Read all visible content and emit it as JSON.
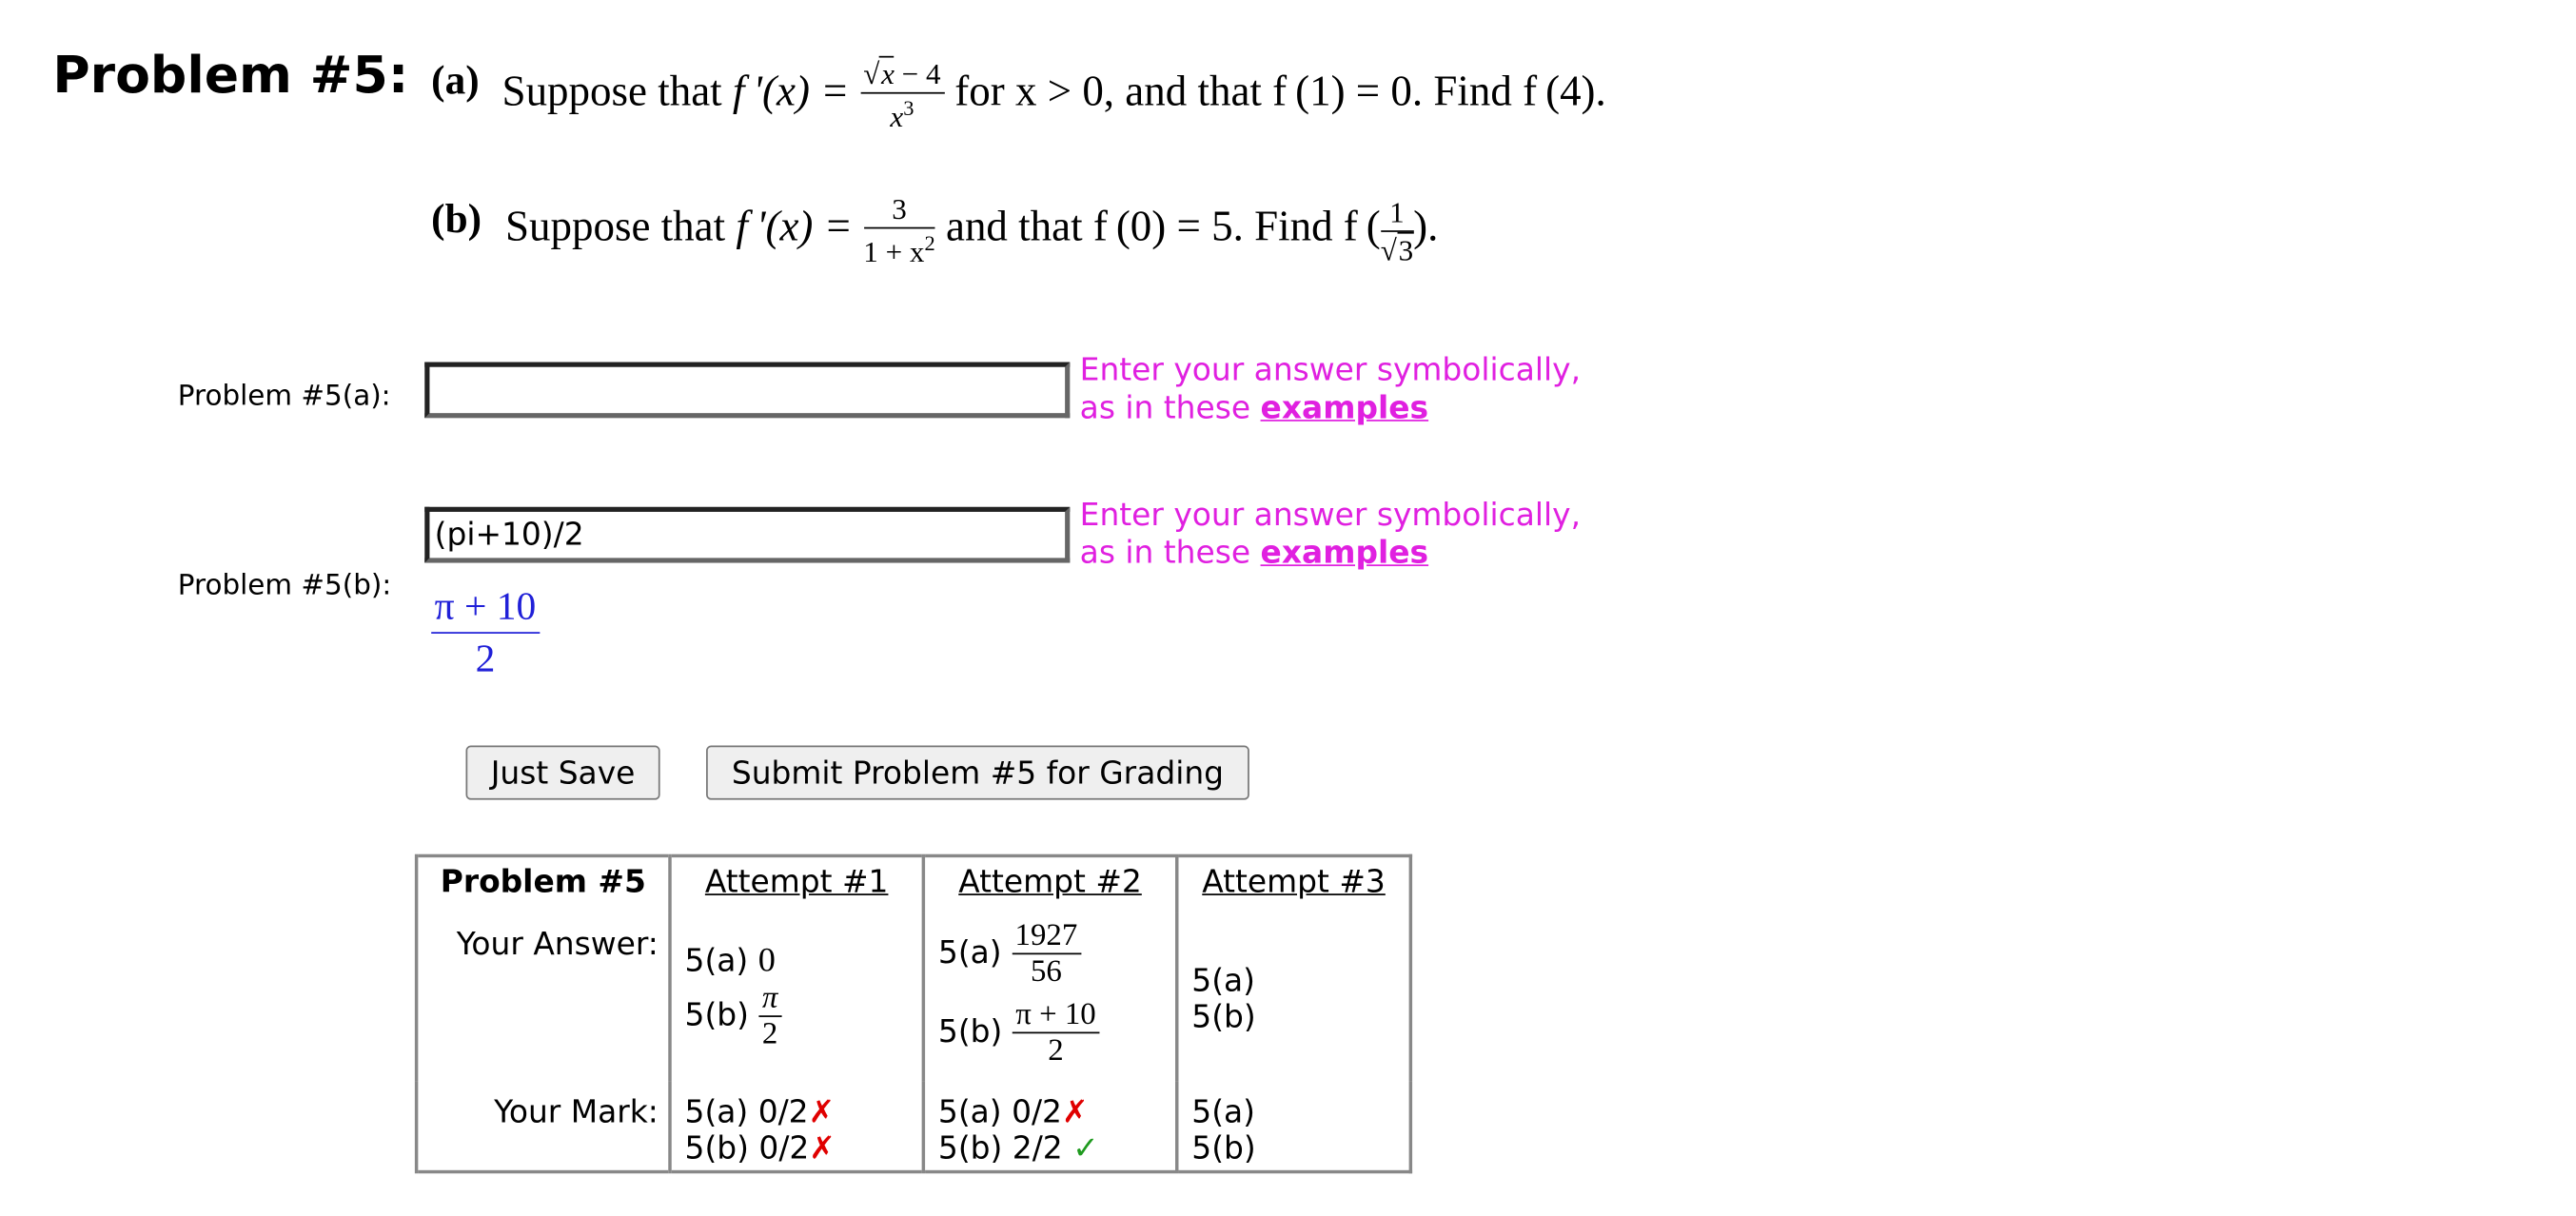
{
  "problem": {
    "title": "Problem #5:",
    "part_a_label": "(a)",
    "part_b_label": "(b)",
    "a_text_1": "Suppose that ",
    "a_fp": "f '(x) = ",
    "a_num": "x",
    "a_num_rest": " − 4",
    "a_den": "x",
    "a_den_exp": "3",
    "a_text_2": " for x > 0, and that f (1) = 0. Find  f (4).",
    "b_text_1": "Suppose that ",
    "b_fp": "f '(x) = ",
    "b_num": "3",
    "b_den": "1 + x",
    "b_den_exp": "2",
    "b_text_2": " and that f (0) = 5. Find  f (",
    "b_arg_num": "1",
    "b_arg_den": "3",
    "b_text_3": ")."
  },
  "answers": {
    "a_label": "Problem #5(a):",
    "a_value": "",
    "b_label": "Problem #5(b):",
    "b_value": "(pi+10)/2",
    "b_preview_num": "π + 10",
    "b_preview_den": "2",
    "hint_line1": "Enter your answer symbolically,",
    "hint_line2": "as in these ",
    "hint_link": "examples"
  },
  "buttons": {
    "just_save": "Just Save",
    "submit": "Submit Problem #5 for Grading"
  },
  "attempts": {
    "header_problem": "Problem #5",
    "header_1": "Attempt #1",
    "header_2": "Attempt #2",
    "header_3": "Attempt #3",
    "your_answer_label": "Your Answer:",
    "your_mark_label": "Your Mark:",
    "a1_a_label": "5(a)",
    "a1_a_value": "0",
    "a1_b_label": "5(b)",
    "a1_b_num": "π",
    "a1_b_den": "2",
    "a2_a_label": "5(a)",
    "a2_a_num": "1927",
    "a2_a_den": "56",
    "a2_b_label": "5(b)",
    "a2_b_num": "π + 10",
    "a2_b_den": "2",
    "a3_a_label": "5(a)",
    "a3_b_label": "5(b)",
    "m1_a": "5(a) 0/2",
    "m1_b": "5(b) 0/2",
    "m2_a": "5(a) 0/2",
    "m2_b": "5(b) 2/2",
    "m3_a": "5(a)",
    "m3_b": "5(b)",
    "cross": "✗",
    "check": "✓"
  },
  "colors": {
    "hint": "#e020e0",
    "preview": "#2020d8",
    "cross": "#e00000",
    "check": "#1f9a1f"
  }
}
